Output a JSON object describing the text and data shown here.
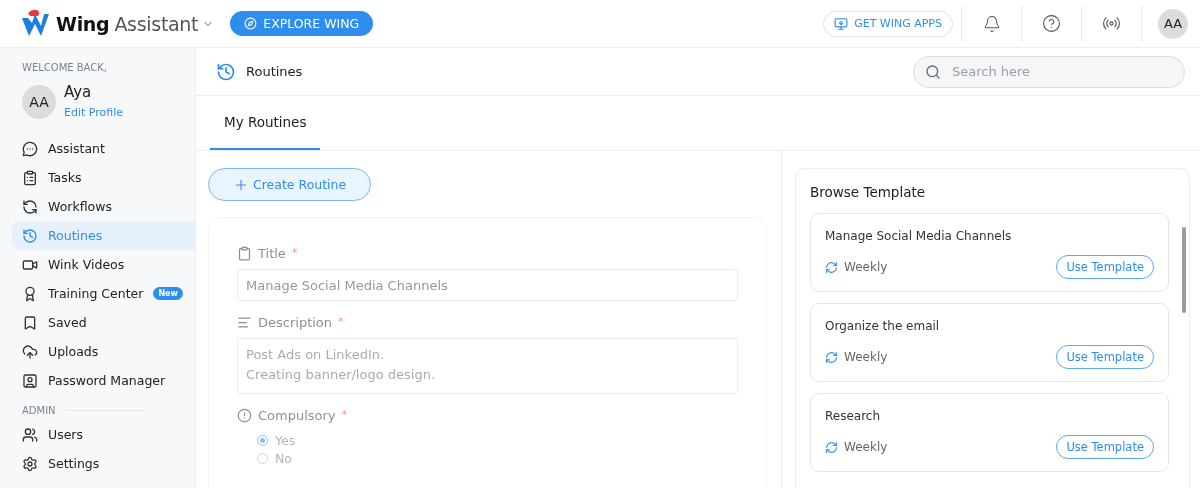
{
  "header": {
    "brand_bold": "Wing",
    "brand_rest": "Assistant",
    "explore_button": "EXPLORE WING",
    "apps_button": "GET WING APPS",
    "avatar": "AA"
  },
  "sidebar": {
    "welcome": "WELCOME BACK,",
    "avatar": "AA",
    "user_name": "Aya",
    "edit_link": "Edit Profile",
    "items": [
      {
        "label": "Assistant",
        "selected": false
      },
      {
        "label": "Tasks",
        "selected": false
      },
      {
        "label": "Workflows",
        "selected": false
      },
      {
        "label": "Routines",
        "selected": true
      },
      {
        "label": "Wink Videos",
        "selected": false
      },
      {
        "label": "Training Center",
        "selected": false,
        "badge": "New"
      },
      {
        "label": "Saved",
        "selected": false
      },
      {
        "label": "Uploads",
        "selected": false
      },
      {
        "label": "Password Manager",
        "selected": false
      }
    ],
    "admin_heading": "ADMIN",
    "admin_items": [
      {
        "label": "Users",
        "selected": false
      },
      {
        "label": "Settings",
        "selected": false
      }
    ]
  },
  "page": {
    "title": "Routines",
    "search": {
      "placeholder": "Search here"
    },
    "tabs": [
      {
        "label": "My Routines",
        "selected": true
      }
    ],
    "create_button": "Create Routine",
    "form": {
      "disabled": true,
      "title_label": "Title",
      "title_value": "Manage Social Media Channels",
      "description_label": "Description",
      "description_lines": [
        "Post Ads on LinkedIn.",
        "Creating banner/logo design."
      ],
      "compulsory_label": "Compulsory",
      "required_mark": "*",
      "options": [
        {
          "label": "Yes",
          "selected": true
        },
        {
          "label": "No",
          "selected": false
        }
      ]
    },
    "templates": {
      "heading": "Browse Template",
      "items": [
        {
          "name": "Manage Social Media Channels",
          "frequency": "Weekly",
          "button": "Use Template"
        },
        {
          "name": "Organize the email",
          "frequency": "Weekly",
          "button": "Use Template"
        },
        {
          "name": "Research",
          "frequency": "Weekly",
          "button": "Use Template"
        }
      ]
    }
  }
}
